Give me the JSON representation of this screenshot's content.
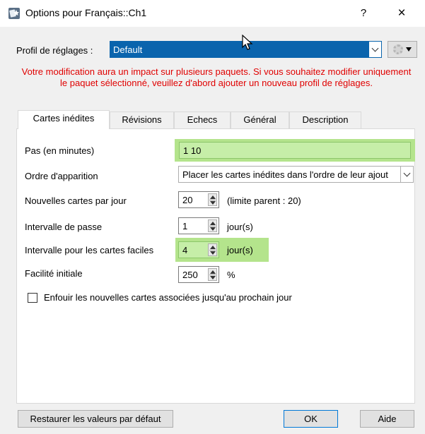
{
  "window": {
    "title": "Options pour Français::Ch1",
    "help_label": "?",
    "close_label": "×"
  },
  "profile": {
    "label": "Profil de réglages :",
    "value": "Default"
  },
  "warning": "Votre modification aura un impact sur plusieurs paquets. Si vous souhaitez modifier uniquement le paquet sélectionné, veuillez d'abord ajouter un nouveau profil de réglages.",
  "tabs": [
    {
      "label": "Cartes inédites",
      "active": true
    },
    {
      "label": "Révisions",
      "active": false
    },
    {
      "label": "Echecs",
      "active": false
    },
    {
      "label": "Général",
      "active": false
    },
    {
      "label": "Description",
      "active": false
    }
  ],
  "fields": {
    "steps": {
      "label": "Pas (en minutes)",
      "value": "1 10"
    },
    "order": {
      "label": "Ordre d'apparition",
      "value": "Placer les cartes inédites dans l'ordre de leur ajout"
    },
    "new_per_day": {
      "label": "Nouvelles cartes par jour",
      "value": "20",
      "suffix": "(limite parent : 20)"
    },
    "graduating_interval": {
      "label": "Intervalle de passe",
      "value": "1",
      "suffix": "jour(s)"
    },
    "easy_interval": {
      "label": "Intervalle pour les cartes faciles",
      "value": "4",
      "suffix": "jour(s)"
    },
    "starting_ease": {
      "label": "Facilité initiale",
      "value": "250",
      "suffix": "%"
    },
    "bury": {
      "label": "Enfouir les nouvelles cartes associées jusqu'au prochain jour",
      "checked": false
    }
  },
  "buttons": {
    "restore": "Restaurer les valeurs par défaut",
    "ok": "OK",
    "help": "Aide"
  },
  "colors": {
    "highlight": "#b4e48c",
    "selection": "#0a64ad",
    "warning": "#e00000"
  }
}
